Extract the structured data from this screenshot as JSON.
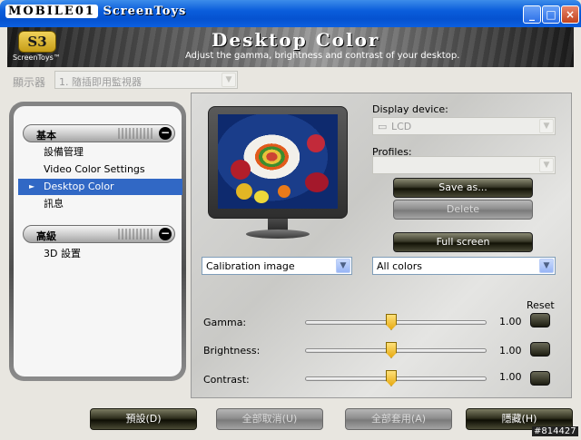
{
  "window": {
    "title_badge": "MOBILE01",
    "title_text": "ScreenToys",
    "buttons": [
      "_",
      "□",
      "×"
    ]
  },
  "banner": {
    "logo_mark": "S3",
    "logo_name": "ScreenToys™",
    "title": "Desktop Color",
    "subtitle": "Adjust the gamma, brightness and contrast of your desktop."
  },
  "monitor_select": {
    "label": "顯示器",
    "value": "1. 隨插即用監視器"
  },
  "sidebar": {
    "groups": [
      {
        "title": "基本",
        "items": [
          {
            "label": "設備管理",
            "selected": false
          },
          {
            "label": "Video Color Settings",
            "selected": false
          },
          {
            "label": "Desktop Color",
            "selected": true
          },
          {
            "label": "訊息",
            "selected": false
          }
        ]
      },
      {
        "title": "高級",
        "items": [
          {
            "label": "3D 設置",
            "selected": false
          }
        ]
      }
    ]
  },
  "panel": {
    "display_device_label": "Display device:",
    "display_device_value": "LCD",
    "profiles_label": "Profiles:",
    "profiles_value": "",
    "save_as_label": "Save as...",
    "delete_label": "Delete",
    "full_screen_label": "Full screen",
    "image_select": "Calibration image",
    "channel_select": "All colors",
    "reset_label": "Reset",
    "sliders": [
      {
        "label": "Gamma:",
        "value": "1.00",
        "level": 0.5
      },
      {
        "label": "Brightness:",
        "value": "1.00",
        "level": 0.5
      },
      {
        "label": "Contrast:",
        "value": "1.00",
        "level": 0.5
      }
    ]
  },
  "footer": {
    "default_label": "預設(D)",
    "cancel_all_label": "全部取消(U)",
    "apply_all_label": "全部套用(A)",
    "hide_label": "隱藏(H)"
  },
  "watermark": "#814427",
  "colors": {
    "selection": "#3168c5",
    "titlebar": "#0a5ddb"
  }
}
